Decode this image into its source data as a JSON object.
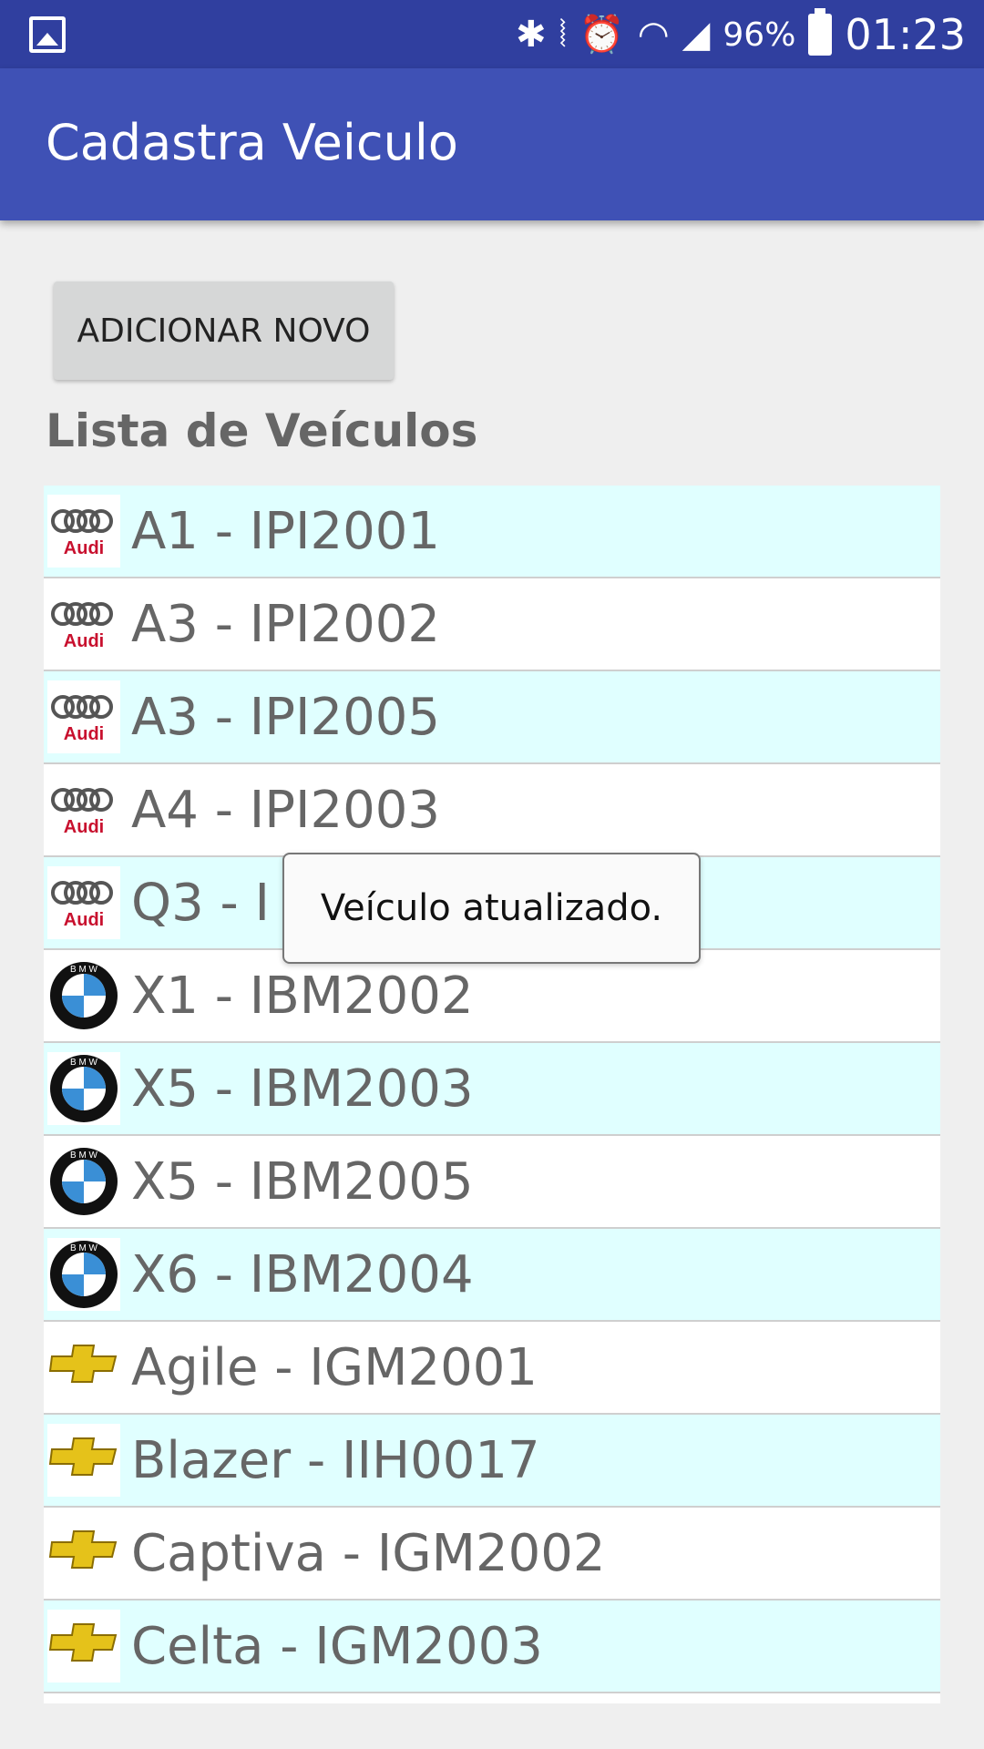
{
  "status_bar": {
    "battery": "96%",
    "time": "01:23",
    "icons": [
      "image-icon",
      "bluetooth-icon",
      "vibrate-icon",
      "alarm-icon",
      "wifi-icon",
      "signal-icon",
      "battery-icon"
    ]
  },
  "app_bar": {
    "title": "Cadastra Veiculo"
  },
  "main": {
    "add_button_label": "ADICIONAR NOVO",
    "list_heading": "Lista de Veículos"
  },
  "vehicles": [
    {
      "label": "A1 - IPI2001",
      "brand": "audi"
    },
    {
      "label": "A3 - IPI2002",
      "brand": "audi"
    },
    {
      "label": "A3 - IPI2005",
      "brand": "audi"
    },
    {
      "label": "A4 - IPI2003",
      "brand": "audi"
    },
    {
      "label": "Q3 - I",
      "brand": "audi"
    },
    {
      "label": "X1 - IBM2002",
      "brand": "bmw"
    },
    {
      "label": "X5 - IBM2003",
      "brand": "bmw"
    },
    {
      "label": "X5 - IBM2005",
      "brand": "bmw"
    },
    {
      "label": "X6 - IBM2004",
      "brand": "bmw"
    },
    {
      "label": "Agile - IGM2001",
      "brand": "chevrolet"
    },
    {
      "label": "Blazer - IIH0017",
      "brand": "chevrolet"
    },
    {
      "label": "Captiva - IGM2002",
      "brand": "chevrolet"
    },
    {
      "label": "Celta - IGM2003",
      "brand": "chevrolet"
    },
    {
      "label": "",
      "brand": "chevrolet"
    }
  ],
  "toast": {
    "message": "Veículo atualizado."
  },
  "colors": {
    "status_bar": "#303f9f",
    "app_bar": "#3f51b5",
    "row_alt": "#e0ffff",
    "row": "#ffffff"
  }
}
